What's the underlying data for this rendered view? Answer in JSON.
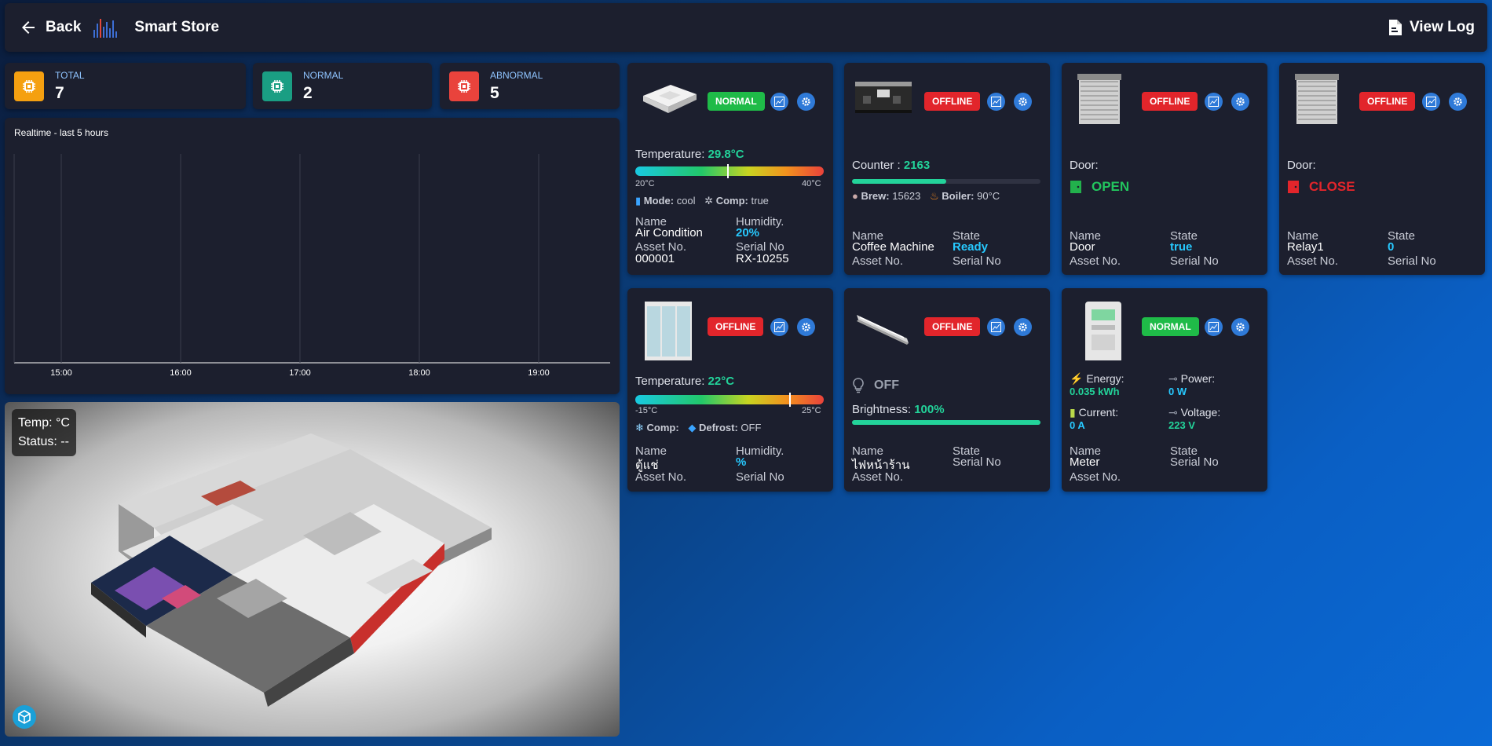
{
  "header": {
    "back_label": "Back",
    "title": "Smart Store",
    "view_log_label": "View Log"
  },
  "stats": [
    {
      "label": "TOTAL",
      "value": "7",
      "color": "#f5a010"
    },
    {
      "label": "NORMAL",
      "value": "2",
      "color": "#1a9e83"
    },
    {
      "label": "ABNORMAL",
      "value": "5",
      "color": "#e9433c"
    }
  ],
  "chart": {
    "title": "Realtime - last 5 hours"
  },
  "chart_data": {
    "type": "line",
    "title": "Realtime - last 5 hours",
    "categories": [
      "15:00",
      "16:00",
      "17:00",
      "18:00",
      "19:00"
    ],
    "series": [],
    "grid": true
  },
  "map": {
    "temp": "Temp: °C",
    "status": "Status: --"
  },
  "devices": {
    "aircon": {
      "badge": "NORMAL",
      "temp_label": "Temperature:",
      "temp_value": "29.8°C",
      "min": "20°C",
      "max": "40°C",
      "level": 0.49,
      "mode_label": "Mode:",
      "mode_value": "cool",
      "comp_label": "Comp:",
      "comp_value": "true",
      "name_label": "Name",
      "name": "Air Condition",
      "hum_label": "Humidity.",
      "hum_value": "20%",
      "asset_label": "Asset No.",
      "asset": "000001",
      "serial_label": "Serial No",
      "serial": "RX-10255"
    },
    "coffee": {
      "badge": "OFFLINE",
      "counter_label": "Counter :",
      "counter_value": "2163",
      "progress": 0.5,
      "brew_label": "Brew:",
      "brew_value": "15623",
      "boiler_label": "Boiler:",
      "boiler_value": "90°C",
      "name_label": "Name",
      "name": "Coffee Machine",
      "state_label": "State",
      "state": "Ready",
      "asset_label": "Asset No.",
      "serial_label": "Serial No"
    },
    "door": {
      "badge": "OFFLINE",
      "door_label": "Door:",
      "door_state": "OPEN",
      "name_label": "Name",
      "name": "Door",
      "state_label": "State",
      "state": "true",
      "asset_label": "Asset No.",
      "serial_label": "Serial No"
    },
    "relay": {
      "badge": "OFFLINE",
      "door_label": "Door:",
      "door_state": "CLOSE",
      "name_label": "Name",
      "name": "Relay1",
      "state_label": "State",
      "state": "0",
      "asset_label": "Asset No.",
      "serial_label": "Serial No"
    },
    "fridge": {
      "badge": "OFFLINE",
      "temp_label": "Temperature:",
      "temp_value": "22°C",
      "min": "-15°C",
      "max": "25°C",
      "level": 0.82,
      "comp_label": "Comp:",
      "defrost_label": "Defrost:",
      "defrost_value": "OFF",
      "name_label": "Name",
      "name": "ตู้แช่",
      "hum_label": "Humidity.",
      "hum_value": "%",
      "asset_label": "Asset No.",
      "serial_label": "Serial No"
    },
    "light": {
      "badge": "OFFLINE",
      "power_state": "OFF",
      "bright_label": "Brightness:",
      "bright_value": "100%",
      "level": 1.0,
      "name_label": "Name",
      "name": "ไฟหน้าร้าน",
      "state_label": "State",
      "asset_label": "Asset No.",
      "serial_label": "Serial No"
    },
    "meter": {
      "badge": "NORMAL",
      "energy_label": "Energy:",
      "energy_value": "0.035 kWh",
      "power_label": "Power:",
      "power_value": "0 W",
      "current_label": "Current:",
      "current_value": "0 A",
      "voltage_label": "Voltage:",
      "voltage_value": "223 V",
      "name_label": "Name",
      "name": "Meter",
      "state_label": "State",
      "asset_label": "Asset No.",
      "serial_label": "Serial No"
    }
  }
}
